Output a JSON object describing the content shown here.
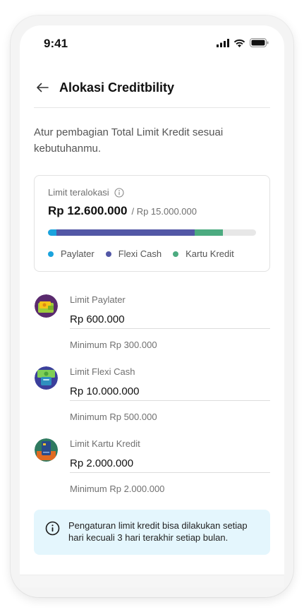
{
  "status_bar": {
    "time": "9:41"
  },
  "header": {
    "title": "Alokasi Creditbility"
  },
  "description": "Atur pembagian Total Limit Kredit sesuai kebutuhanmu.",
  "summary": {
    "label": "Limit teralokasi",
    "used": "Rp 12.600.000",
    "total": "/ Rp 15.000.000",
    "allocation": [
      {
        "name": "Paylater",
        "amount": 600000,
        "color": "#1aa3dd"
      },
      {
        "name": "Flexi Cash",
        "amount": 10000000,
        "color": "#5257a6"
      },
      {
        "name": "Kartu Kredit",
        "amount": 2000000,
        "color": "#4cab80"
      }
    ],
    "total_amount": 15000000,
    "legend": [
      {
        "label": "Paylater",
        "color": "#1aa3dd"
      },
      {
        "label": "Flexi Cash",
        "color": "#5257a6"
      },
      {
        "label": "Kartu Kredit",
        "color": "#4cab80"
      }
    ]
  },
  "limits": [
    {
      "label": "Limit Paylater",
      "value": "Rp 600.000",
      "minimum": "Minimum Rp 300.000",
      "icon": "paylater-wallet-icon"
    },
    {
      "label": "Limit Flexi Cash",
      "value": "Rp 10.000.000",
      "minimum": "Minimum Rp 500.000",
      "icon": "flexi-cash-money-icon"
    },
    {
      "label": "Limit Kartu Kredit",
      "value": "Rp 2.000.000",
      "minimum": "Minimum Rp 2.000.000",
      "icon": "credit-card-icon"
    }
  ],
  "info": {
    "text": "Pengaturan limit kredit bisa dilakukan setiap hari kecuali 3 hari terakhir setiap bulan."
  }
}
